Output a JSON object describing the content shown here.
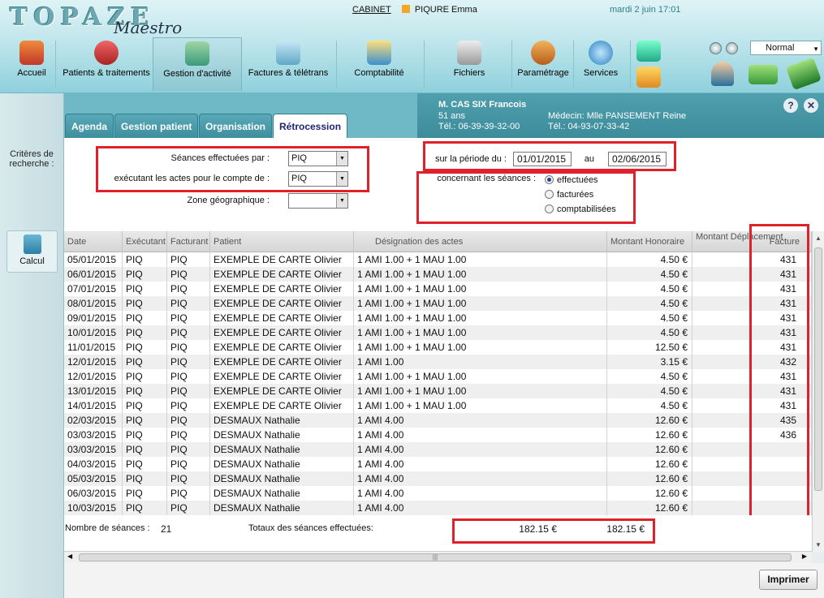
{
  "app": {
    "logo": "TOPAZE",
    "logo_sub": "Maestro",
    "cabinet_link": "CABINET",
    "current_user": "PIQURE Emma",
    "datetime": "mardi 2 juin 17:01"
  },
  "nav": [
    {
      "label": "Accueil",
      "icon": "home-icon"
    },
    {
      "label": "Patients & traitements",
      "icon": "patients-icon"
    },
    {
      "label": "Gestion d'activité",
      "icon": "activity-icon"
    },
    {
      "label": "Factures & télétrans",
      "icon": "invoice-icon"
    },
    {
      "label": "Comptabilité",
      "icon": "accounting-icon"
    },
    {
      "label": "Fichiers",
      "icon": "database-icon"
    },
    {
      "label": "Paramétrage",
      "icon": "settings-icon"
    },
    {
      "label": "Services",
      "icon": "globe-icon"
    }
  ],
  "view_mode": "Normal",
  "patient": {
    "name": "M. CAS SIX Francois",
    "age": "51 ans",
    "tel": "Tél.: 06-39-39-32-00",
    "medecin": "Médecin: Mlle PANSEMENT Reine",
    "medecin_tel": "Tél.: 04-93-07-33-42"
  },
  "tabs": [
    "Agenda",
    "Gestion patient",
    "Organisation",
    "Rétrocession"
  ],
  "sidebar": {
    "criteria_label": "Critères de recherche :",
    "calc_label": "Calcul"
  },
  "criteria": {
    "seances_par_label": "Séances effectuées par :",
    "seances_par_value": "PIQ",
    "compte_de_label": "exécutant les actes pour le compte de :",
    "compte_de_value": "PIQ",
    "zone_label": "Zone géographique :",
    "zone_value": "",
    "periode_label": "sur la période du :",
    "date_from": "01/01/2015",
    "au_label": "au",
    "date_to": "02/06/2015",
    "seances_label": "concernant les séances :",
    "radio_effectuees": "effectuées",
    "radio_facturees": "facturées",
    "radio_comptabilisees": "comptabilisées",
    "selected": "effectuées"
  },
  "table": {
    "headers": {
      "date": "Date",
      "executant": "Exécutant",
      "facturant": "Facturant",
      "patient": "Patient",
      "designation": "Désignation des actes",
      "honoraire": "Montant Honoraire",
      "deplacement": "Montant Déplacement",
      "facture": "Facture"
    },
    "rows": [
      [
        "05/01/2015",
        "PIQ",
        "PIQ",
        "EXEMPLE DE CARTE Olivier",
        "1 AMI 1.00 + 1 MAU 1.00",
        "4.50 €",
        "",
        "431"
      ],
      [
        "06/01/2015",
        "PIQ",
        "PIQ",
        "EXEMPLE DE CARTE Olivier",
        "1 AMI 1.00 + 1 MAU 1.00",
        "4.50 €",
        "",
        "431"
      ],
      [
        "07/01/2015",
        "PIQ",
        "PIQ",
        "EXEMPLE DE CARTE Olivier",
        "1 AMI 1.00 + 1 MAU 1.00",
        "4.50 €",
        "",
        "431"
      ],
      [
        "08/01/2015",
        "PIQ",
        "PIQ",
        "EXEMPLE DE CARTE Olivier",
        "1 AMI 1.00 + 1 MAU 1.00",
        "4.50 €",
        "",
        "431"
      ],
      [
        "09/01/2015",
        "PIQ",
        "PIQ",
        "EXEMPLE DE CARTE Olivier",
        "1 AMI 1.00 + 1 MAU 1.00",
        "4.50 €",
        "",
        "431"
      ],
      [
        "10/01/2015",
        "PIQ",
        "PIQ",
        "EXEMPLE DE CARTE Olivier",
        "1 AMI 1.00 + 1 MAU 1.00",
        "4.50 €",
        "",
        "431"
      ],
      [
        "11/01/2015",
        "PIQ",
        "PIQ",
        "EXEMPLE DE CARTE Olivier",
        "1 AMI 1.00 + 1 MAU 1.00",
        "12.50 €",
        "",
        "431"
      ],
      [
        "12/01/2015",
        "PIQ",
        "PIQ",
        "EXEMPLE DE CARTE Olivier",
        "1 AMI 1.00",
        "3.15 €",
        "",
        "432"
      ],
      [
        "12/01/2015",
        "PIQ",
        "PIQ",
        "EXEMPLE DE CARTE Olivier",
        "1 AMI 1.00 + 1 MAU 1.00",
        "4.50 €",
        "",
        "431"
      ],
      [
        "13/01/2015",
        "PIQ",
        "PIQ",
        "EXEMPLE DE CARTE Olivier",
        "1 AMI 1.00 + 1 MAU 1.00",
        "4.50 €",
        "",
        "431"
      ],
      [
        "14/01/2015",
        "PIQ",
        "PIQ",
        "EXEMPLE DE CARTE Olivier",
        "1 AMI 1.00 + 1 MAU 1.00",
        "4.50 €",
        "",
        "431"
      ],
      [
        "02/03/2015",
        "PIQ",
        "PIQ",
        "DESMAUX Nathalie",
        "1 AMI 4.00",
        "12.60 €",
        "",
        "435"
      ],
      [
        "03/03/2015",
        "PIQ",
        "PIQ",
        "DESMAUX Nathalie",
        "1 AMI 4.00",
        "12.60 €",
        "",
        "436"
      ],
      [
        "03/03/2015",
        "PIQ",
        "PIQ",
        "DESMAUX Nathalie",
        "1 AMI 4.00",
        "12.60 €",
        "",
        ""
      ],
      [
        "04/03/2015",
        "PIQ",
        "PIQ",
        "DESMAUX Nathalie",
        "1 AMI 4.00",
        "12.60 €",
        "",
        ""
      ],
      [
        "05/03/2015",
        "PIQ",
        "PIQ",
        "DESMAUX Nathalie",
        "1 AMI 4.00",
        "12.60 €",
        "",
        ""
      ],
      [
        "06/03/2015",
        "PIQ",
        "PIQ",
        "DESMAUX Nathalie",
        "1 AMI 4.00",
        "12.60 €",
        "",
        ""
      ],
      [
        "10/03/2015",
        "PIQ",
        "PIQ",
        "DESMAUX Nathalie",
        "1 AMI 4.00",
        "12.60 €",
        "",
        ""
      ]
    ]
  },
  "totals": {
    "count_label": "Nombre de séances :",
    "count_value": "21",
    "totals_label": "Totaux des séances effectuées:",
    "total_honoraire": "182.15 €",
    "total_global": "182.15 €"
  },
  "print_label": "Imprimer",
  "colors": {
    "highlight_box": "#e0202a",
    "header_teal": "#3e8e9d",
    "tab_active_text": "#222277"
  }
}
